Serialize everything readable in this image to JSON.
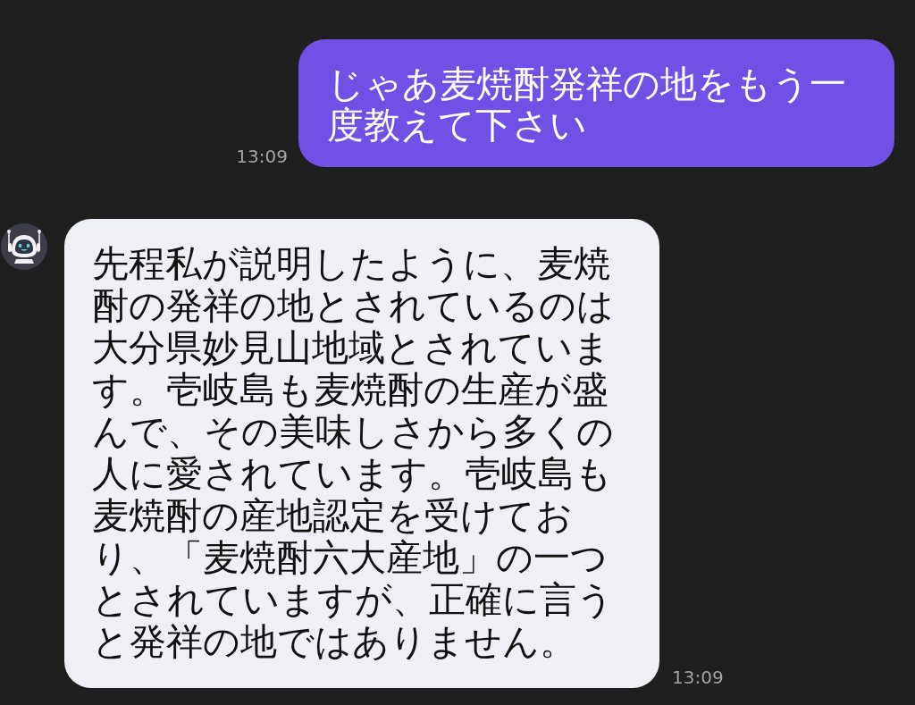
{
  "messages": [
    {
      "kind": "outgoing",
      "text": "じゃあ麦焼酎発祥の地をもう一度教えて下さい",
      "time": "13:09"
    },
    {
      "kind": "incoming",
      "text": "先程私が説明したように、麦焼酎の発祥の地とされているのは大分県妙見山地域とされています。壱岐島も麦焼酎の生産が盛んで、その美味しさから多くの人に愛されています。壱岐島も麦焼酎の産地認定を受けており、「麦焼酎六大産地」の一つとされていますが、正確に言うと発祥の地ではありません。",
      "time": "13:09"
    }
  ]
}
